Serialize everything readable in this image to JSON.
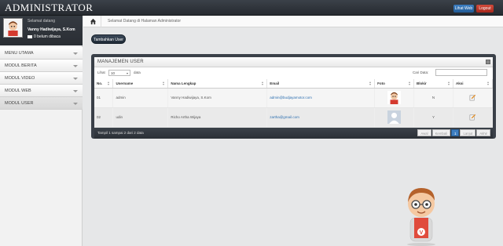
{
  "header": {
    "brand": "ADMINISTRATOR",
    "view_web": "Lihat Web",
    "logout": "Logout"
  },
  "profile": {
    "welcome": "Selamat datang",
    "name": "Vanny Hadiwijaya, S.Kom",
    "unread": "0 belum dibaca"
  },
  "menu": [
    {
      "label": "MENU UTAMA"
    },
    {
      "label": "MODUL BERITA"
    },
    {
      "label": "MODUL VIDEO"
    },
    {
      "label": "MODUL WEB"
    },
    {
      "label": "MODUL USER"
    }
  ],
  "breadcrumb": "Selamat Datang di Halaman Administrator",
  "add_button": "Tambahkan User",
  "panel": {
    "title": "MANAJEMEN USER",
    "show_label": "Lihat",
    "show_value": "10",
    "show_suffix": "data",
    "search_label": "Cari Data:"
  },
  "table": {
    "headers": [
      "No.",
      "Username",
      "Nama Lengkap",
      "Email",
      "Foto",
      "Blokir",
      "Aksi"
    ],
    "rows": [
      {
        "no": "01",
        "username": "admin",
        "nama": "Vanny Hadiwijaya, S.Kom",
        "email": "admin@budjayamotor.com",
        "blokir": "N"
      },
      {
        "no": "02",
        "username": "udin",
        "nama": "Richo Artha Wijaya",
        "email": "zartha@gmail.com",
        "blokir": "Y"
      }
    ]
  },
  "footer": {
    "info": "Tampil 1 sampai 2 dari 2 data",
    "pages": [
      "Awal",
      "Kembali",
      "1",
      "Lanjut",
      "Akhir"
    ]
  },
  "colors": {
    "topbar": "#2f343a",
    "accent_blue": "#2d6fb0",
    "logout_red": "#c0392b"
  }
}
